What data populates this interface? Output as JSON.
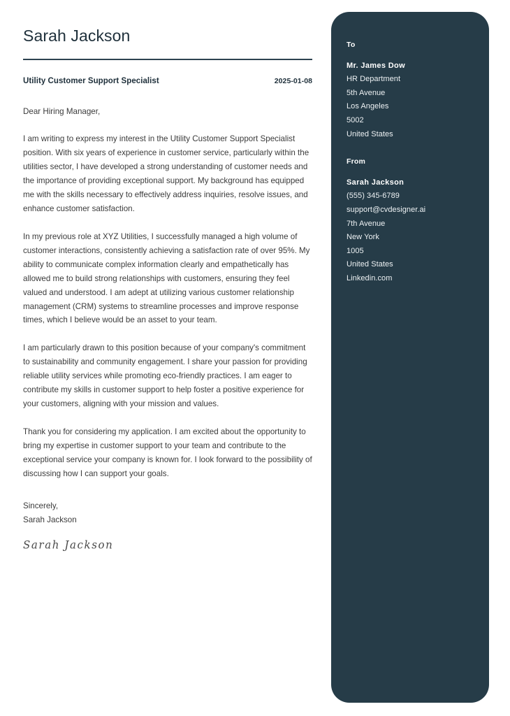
{
  "document": {
    "type": "cover-letter",
    "accent_color": "#263c48",
    "rule_color": "#2d4250",
    "body_text_color": "#3b3b3b",
    "page_background": "#ffffff"
  },
  "header": {
    "applicant_name": "Sarah Jackson",
    "job_title": "Utility Customer Support Specialist",
    "date": "2025-01-08"
  },
  "letter": {
    "salutation": "Dear Hiring Manager,",
    "paragraphs": [
      "I am writing to express my interest in the Utility Customer Support Specialist position. With six years of experience in customer service, particularly within the utilities sector, I have developed a strong understanding of customer needs and the importance of providing exceptional support. My background has equipped me with the skills necessary to effectively address inquiries, resolve issues, and enhance customer satisfaction.",
      "In my previous role at XYZ Utilities, I successfully managed a high volume of customer interactions, consistently achieving a satisfaction rate of over 95%. My ability to communicate complex information clearly and empathetically has allowed me to build strong relationships with customers, ensuring they feel valued and understood. I am adept at utilizing various customer relationship management (CRM) systems to streamline processes and improve response times, which I believe would be an asset to your team.",
      "I am particularly drawn to this position because of your company's commitment to sustainability and community engagement. I share your passion for providing reliable utility services while promoting eco-friendly practices. I am eager to contribute my skills in customer support to help foster a positive experience for your customers, aligning with your mission and values.",
      "Thank you for considering my application. I am excited about the opportunity to bring my expertise in customer support to your team and contribute to the exceptional service your company is known for. I look forward to the possibility of discussing how I can support your goals."
    ],
    "closing_phrase": "Sincerely,",
    "closing_name": "Sarah Jackson",
    "signature": "Sarah Jackson"
  },
  "sidebar": {
    "to": {
      "heading": "To",
      "lines": [
        "Mr. James Dow",
        "HR Department",
        "5th Avenue",
        "Los Angeles",
        "5002",
        "United States"
      ]
    },
    "from": {
      "heading": "From",
      "lines": [
        "Sarah Jackson",
        "(555) 345-6789",
        "support@cvdesigner.ai",
        "7th Avenue",
        "New York",
        "1005",
        "United States",
        "Linkedin.com"
      ]
    }
  }
}
